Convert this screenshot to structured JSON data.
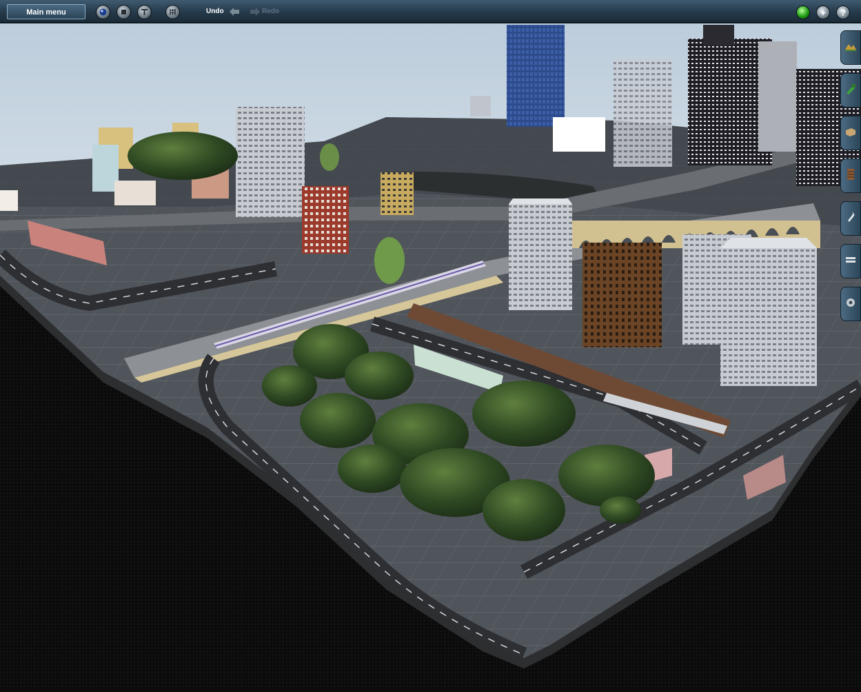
{
  "toolbar": {
    "main_menu_label": "Main menu",
    "undo_label": "Undo",
    "redo_label": "Redo",
    "tools": [
      "driver-tool-icon",
      "stop-icon",
      "track-tool-icon",
      "grid-icon"
    ],
    "right_buttons": [
      "status-light-icon",
      "plus-icon",
      "help-icon"
    ],
    "plus_glyph": "+",
    "help_glyph": "?"
  },
  "side_palette": {
    "tabs": [
      "topology-tool-icon",
      "track-paint-icon",
      "objects-icon",
      "tracks-icon",
      "wrench-icon",
      "layers-icon",
      "settings-icon"
    ]
  },
  "colors": {
    "toolbar_bg": "#2b4355",
    "sky": "#c9d6e2",
    "ground": "#4a4e55",
    "void": "#0c0c0c",
    "accent_green": "#1e9c16"
  }
}
